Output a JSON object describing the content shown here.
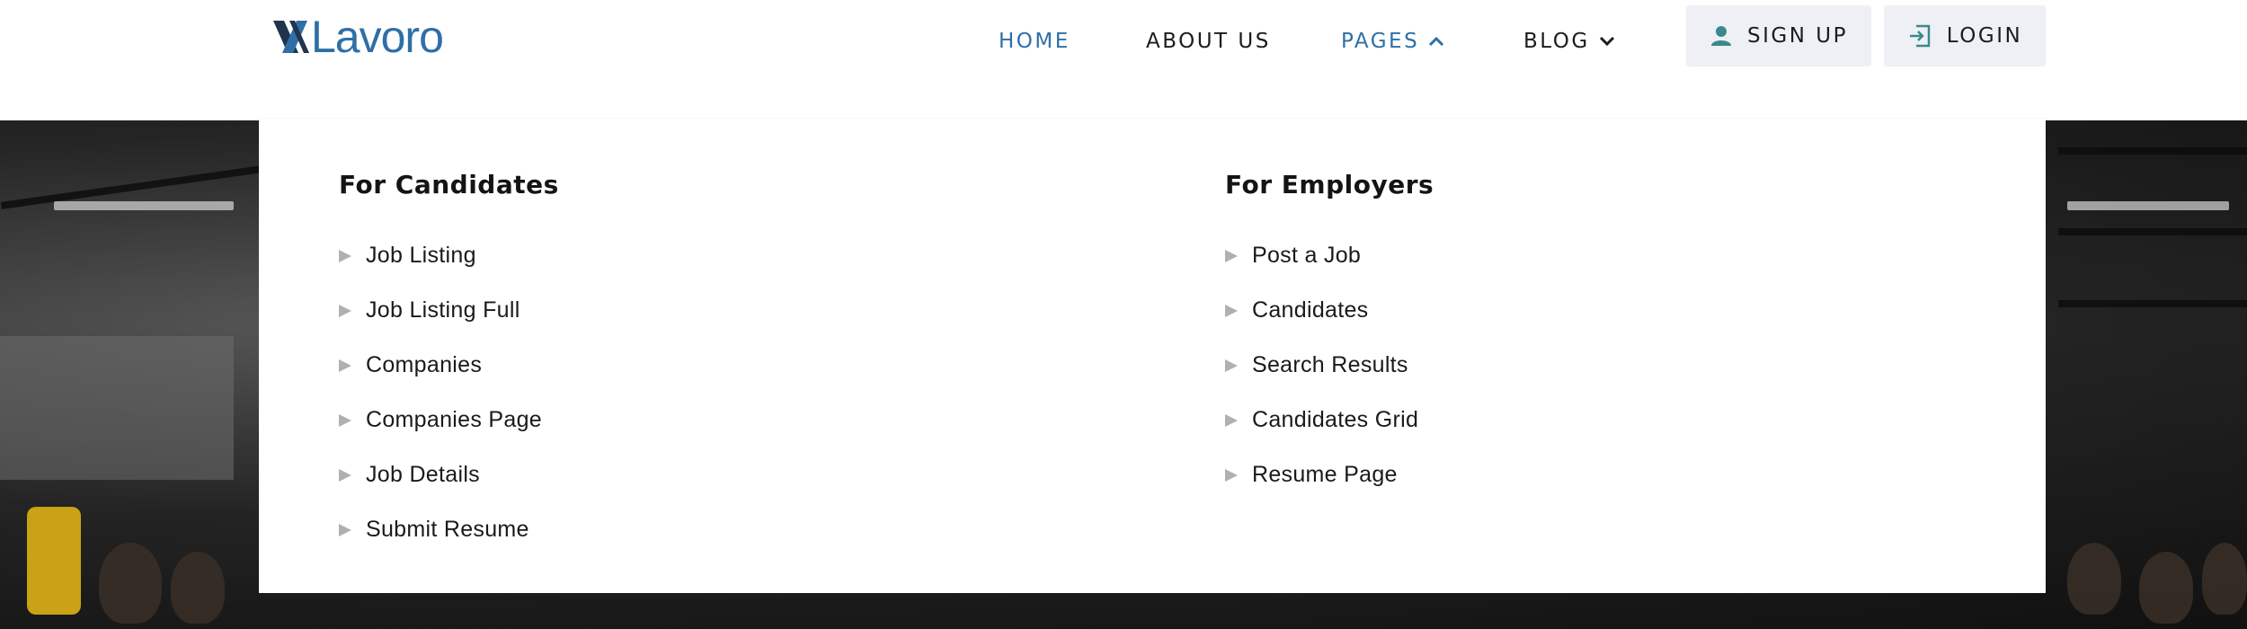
{
  "brand": {
    "name": "Lavoro",
    "accent_color": "#2f6fa6"
  },
  "nav": {
    "items": [
      {
        "label": "HOME",
        "active": true
      },
      {
        "label": "ABOUT US",
        "active": false
      },
      {
        "label": "PAGES",
        "active": true,
        "icon": "chevron-up-icon"
      },
      {
        "label": "BLOG",
        "active": false,
        "icon": "chevron-down-icon"
      }
    ],
    "signup": {
      "label": "SIGN UP",
      "icon": "user-icon"
    },
    "login": {
      "label": "LOGIN",
      "icon": "login-icon"
    }
  },
  "dropdown": {
    "candidates": {
      "title": "For Candidates",
      "items": [
        "Job Listing",
        "Job Listing Full",
        "Companies",
        "Companies Page",
        "Job Details",
        "Submit Resume"
      ]
    },
    "employers": {
      "title": "For Employers",
      "items": [
        "Post a Job",
        "Candidates",
        "Search Results",
        "Candidates Grid",
        "Resume Page"
      ]
    }
  }
}
